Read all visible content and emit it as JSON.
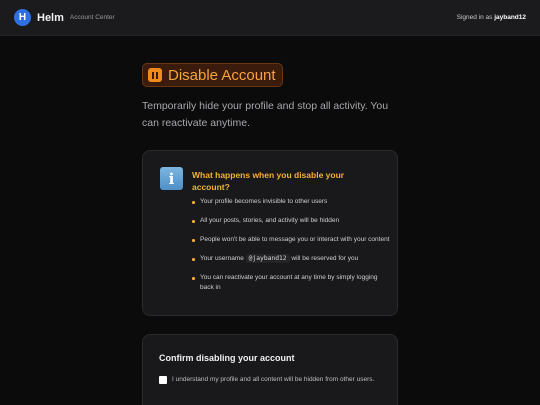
{
  "header": {
    "logo_letter": "H",
    "brand": "Helm",
    "brand_sub": "Account Center",
    "signed_in_prefix": "Signed in as",
    "username": "jayband12"
  },
  "page": {
    "title": "Disable Account",
    "subtitle": "Temporarily hide your profile and stop all activity. You can reactivate anytime."
  },
  "info": {
    "title": "What happens when you disable your account?",
    "bullets": [
      "Your profile becomes invisible to other users",
      "All your posts, stories, and activity will be hidden",
      "People won't be able to message you or interact with your content",
      "Your username",
      "You can reactivate your account at any time by simply logging back in"
    ],
    "username_code": "@jayband12",
    "username_suffix": "will be reserved for you"
  },
  "confirm": {
    "title": "Confirm disabling your account",
    "checkbox_label": "I understand my profile and all content will be hidden from other users.",
    "checked": false
  },
  "colors": {
    "accent": "#f5a53a",
    "info_title": "#f2b233",
    "brand_blue": "#2f6fe4"
  }
}
